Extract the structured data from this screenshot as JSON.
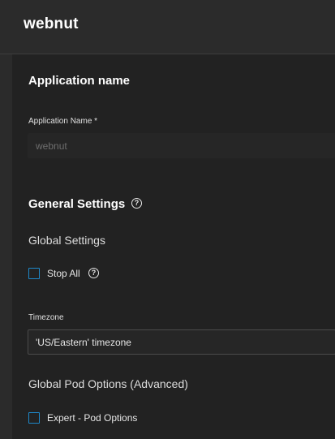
{
  "header": {
    "app_title": "webnut"
  },
  "application_name_section": {
    "title": "Application name",
    "field_label": "Application Name *",
    "field_value": "webnut"
  },
  "general_settings": {
    "title": "General Settings",
    "help_icon": "help-circle-icon",
    "global_settings_title": "Global Settings",
    "stop_all": {
      "label": "Stop All",
      "checked": false,
      "help_icon": "help-circle-icon"
    },
    "timezone": {
      "label": "Timezone",
      "value": "'US/Eastern' timezone"
    },
    "pod_options_title": "Global Pod Options (Advanced)",
    "expert_pod_options": {
      "label": "Expert - Pod Options",
      "checked": false
    }
  },
  "colors": {
    "accent": "#1e88c9",
    "background": "#222222",
    "header_background": "#2b2b2b"
  }
}
